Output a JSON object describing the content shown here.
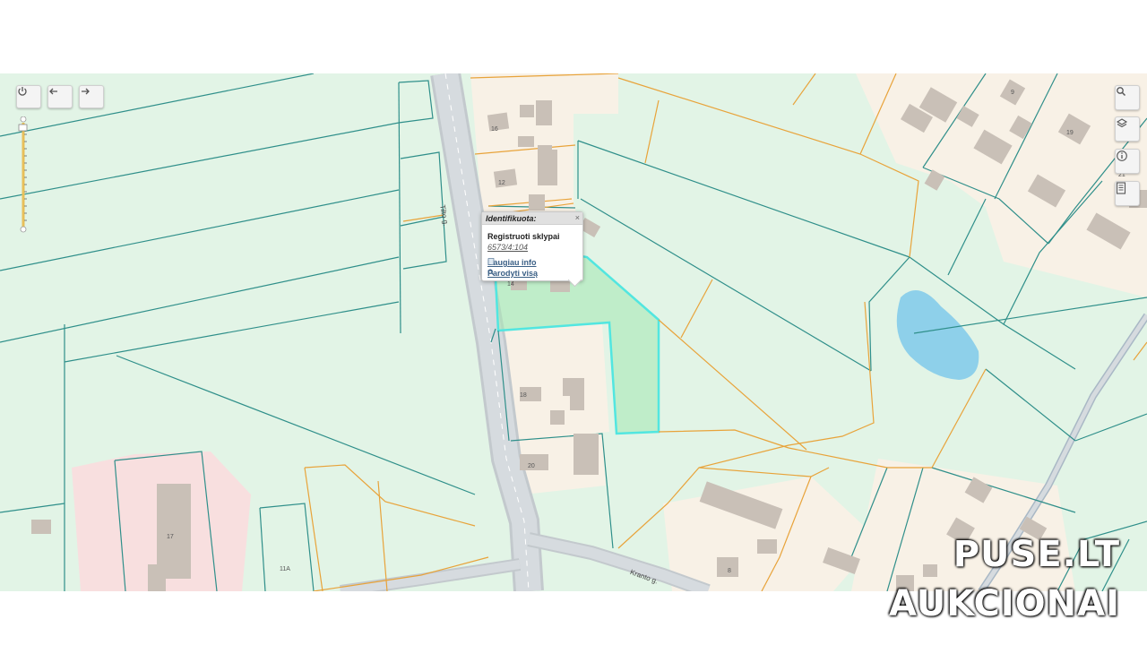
{
  "map": {
    "controls_left": [
      {
        "name": "power",
        "icon": "power-icon"
      },
      {
        "name": "back",
        "icon": "arrow-left-icon"
      },
      {
        "name": "forward",
        "icon": "arrow-right-icon"
      }
    ],
    "controls_right": [
      {
        "name": "search",
        "icon": "search-icon"
      },
      {
        "name": "layers",
        "icon": "layers-icon"
      },
      {
        "name": "info",
        "icon": "info-icon"
      },
      {
        "name": "legend",
        "icon": "document-icon"
      }
    ],
    "popup": {
      "header": "Identifikuota:",
      "close": "×",
      "title": "Registruoti sklypai",
      "parcel_id": "6573/4:104",
      "link_more": "Daugiau info",
      "link_show_all": "Parodyti visą"
    },
    "streets": {
      "main": "Tilto g.",
      "side": "Kranto g."
    },
    "house_numbers": {
      "h1": "16",
      "h2": "12",
      "h3": "14",
      "h4": "18",
      "h5": "20",
      "h6": "17",
      "h7": "11A",
      "h8": "19",
      "h9": "21",
      "h10": "9",
      "h11": "8"
    },
    "colors": {
      "land": "#e2f4e6",
      "parcel_outline": "#2f8f8a",
      "boundary_orange": "#e8a33a",
      "built_area": "#f8f1e6",
      "building": "#c9c0b7",
      "road": "#d3d8dc",
      "water": "#8ed0ea",
      "selected": "#52e6e0",
      "pink_area": "#f8dfdf"
    }
  },
  "watermark": {
    "line1": "PUSE.LT",
    "line2": "AUKCIONAI"
  }
}
